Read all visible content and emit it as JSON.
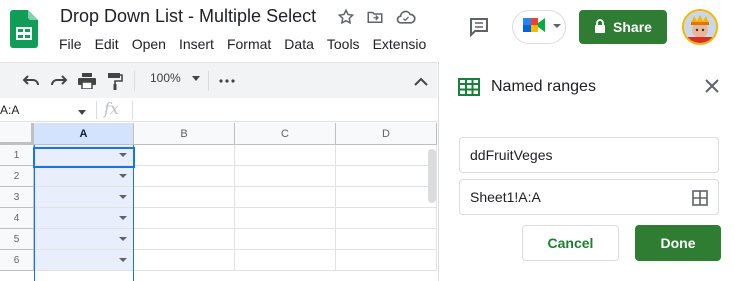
{
  "doc": {
    "title": "Drop Down List - Multiple Select"
  },
  "menu": [
    "File",
    "Edit",
    "Open",
    "Insert",
    "Format",
    "Data",
    "Tools",
    "Extensio"
  ],
  "header": {
    "share_label": "Share"
  },
  "toolbar": {
    "zoom": "100%"
  },
  "formula_bar": {
    "name_box": "A:A",
    "fx": "fx"
  },
  "grid": {
    "columns": [
      "A",
      "B",
      "C",
      "D"
    ],
    "selected_column": "A",
    "rows": [
      "1",
      "2",
      "3",
      "4",
      "5",
      "6"
    ]
  },
  "panel": {
    "title": "Named ranges",
    "name_value": "ddFruitVeges",
    "range_value": "Sheet1!A:A",
    "cancel_label": "Cancel",
    "done_label": "Done"
  },
  "colors": {
    "accent_green": "#2e7d32",
    "selection_blue": "#1a73e8"
  }
}
